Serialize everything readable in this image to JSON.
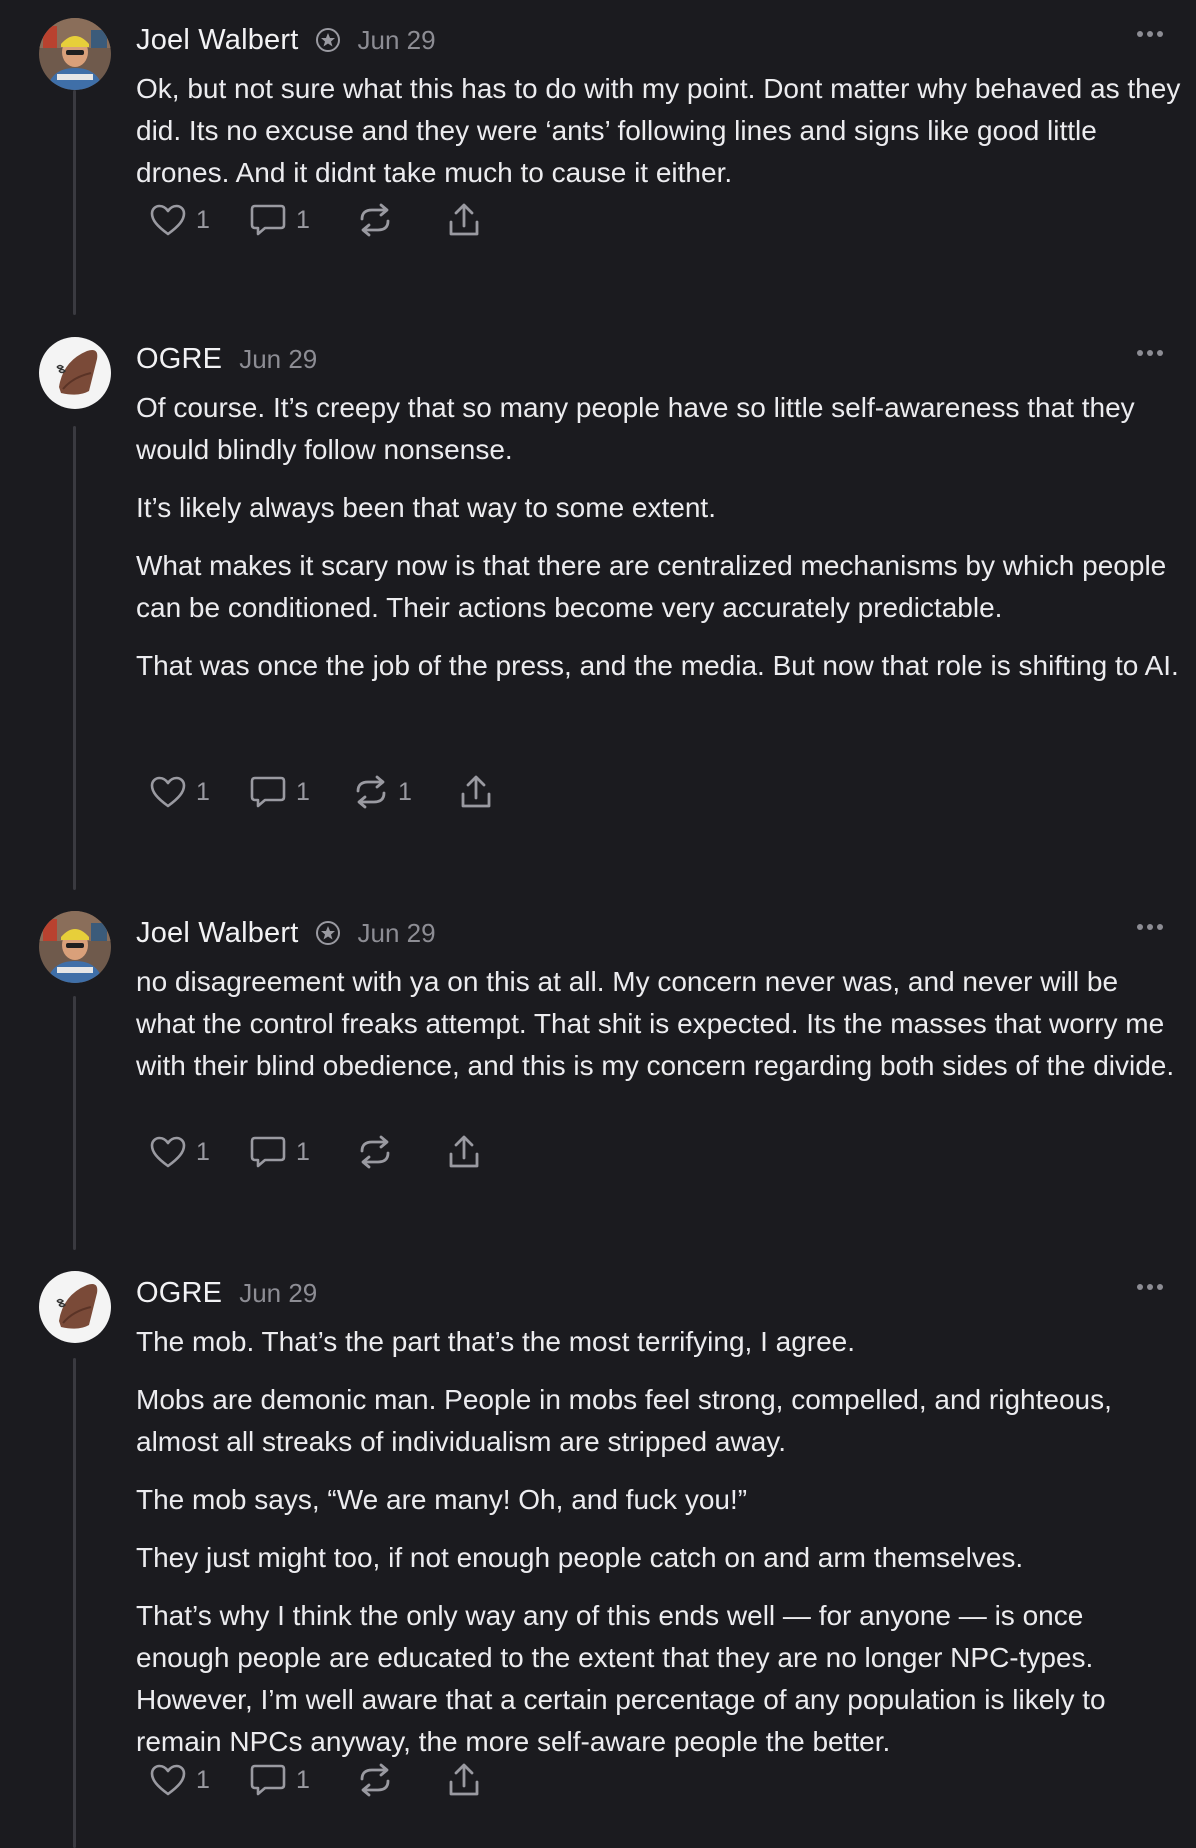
{
  "comments": [
    {
      "author": "Joel Walbert",
      "verified": true,
      "avatar_icon": "user-photo-avatar",
      "date": "Jun 29",
      "paragraphs": [
        "Ok, but not sure what this has to do with my point. Dont matter why behaved as they did. Its no excuse and they were ‘ants’ following lines and signs like good little drones. And it didnt take much to cause it either."
      ],
      "likes": "1",
      "replies": "1",
      "restacks": ""
    },
    {
      "author": "OGRE",
      "verified": false,
      "avatar_icon": "ogre-avatar",
      "date": "Jun 29",
      "paragraphs": [
        "Of course. It’s creepy that so many people have so little self-awareness that they would blindly follow nonsense.",
        "It’s likely always been that way to some extent.",
        "What makes it scary now is that there are centralized mechanisms by which people can be conditioned. Their actions become very accurately predictable.",
        "That was once the job of the press, and the media. But now that role is shifting to AI."
      ],
      "likes": "1",
      "replies": "1",
      "restacks": "1"
    },
    {
      "author": "Joel Walbert",
      "verified": true,
      "avatar_icon": "user-photo-avatar",
      "date": "Jun 29",
      "paragraphs": [
        "no disagreement with ya on this at all. My concern never was, and never will be what the control freaks attempt. That shit is expected. Its the masses that worry me with their blind obedience, and this is my concern regarding both sides of the divide."
      ],
      "likes": "1",
      "replies": "1",
      "restacks": ""
    },
    {
      "author": "OGRE",
      "verified": false,
      "avatar_icon": "ogre-avatar",
      "date": "Jun 29",
      "paragraphs": [
        "The mob. That’s the part that’s the most terrifying, I agree.",
        "Mobs are demonic man. People in mobs feel strong, compelled, and righteous, almost all streaks of individualism are stripped away.",
        "The mob says, “We are many! Oh, and fuck you!”",
        "They just might too, if not enough people catch on and arm themselves.",
        "That’s why I think the only way any of this ends well — for anyone — is once enough people are educated to the extent that they are no longer NPC-types. However, I’m well aware that a certain percentage of any population is likely to remain NPCs anyway, the more self-aware people the better."
      ],
      "likes": "1",
      "replies": "1",
      "restacks": ""
    }
  ],
  "icons": {
    "like": "heart-icon",
    "reply": "comment-bubble-icon",
    "restack": "restack-icon",
    "share": "share-icon",
    "more": "more-options-icon",
    "verified": "verified-badge-icon"
  },
  "colors": {
    "background": "#1b1b1f",
    "text": "#ececef",
    "muted": "#8d8d94",
    "thread_line": "#3a3a40",
    "ogre_avatar_bg": "#f4f4f4",
    "ogre_shape": "#7a4a38"
  }
}
